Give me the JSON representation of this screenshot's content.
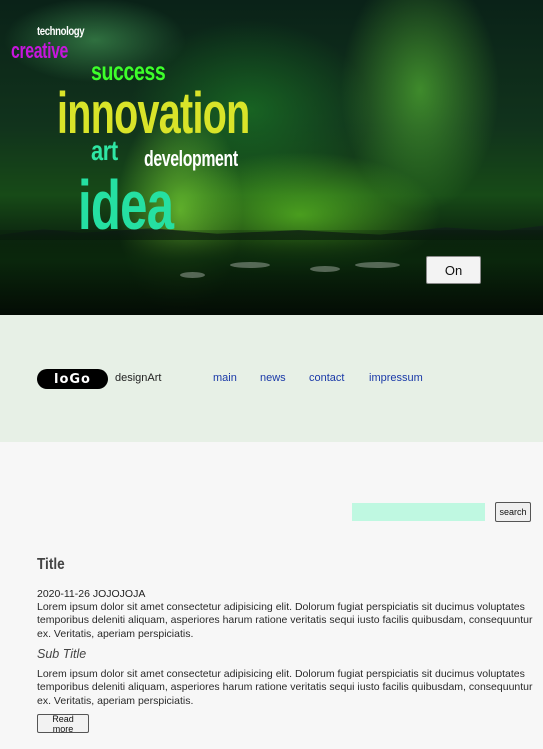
{
  "hero": {
    "words": {
      "technology": "technology",
      "creative": "creative",
      "success": "success",
      "innovation": "innovation",
      "art": "art",
      "development": "development",
      "idea": "idea"
    },
    "toggle_label": "On"
  },
  "header": {
    "logo_text": "loGo",
    "brand_name": "designArt",
    "nav": {
      "main": "main",
      "news": "news",
      "contact": "contact",
      "impressum": "impressum"
    }
  },
  "search": {
    "value": "",
    "button_label": "search"
  },
  "article": {
    "title": "Title",
    "meta": "2020-11-26 JOJOJOJA",
    "body_1": "Lorem ipsum dolor sit amet consectetur adipisicing elit. Dolorum fugiat perspiciatis sit ducimus voluptates temporibus deleniti aliquam, asperiores harum ratione veritatis sequi iusto facilis quibusdam, consequuntur ex. Veritatis, aperiam perspiciatis.",
    "subtitle": "Sub Title",
    "body_2": "Lorem ipsum dolor sit amet consectetur adipisicing elit. Dolorum fugiat perspiciatis sit ducimus voluptates temporibus deleniti aliquam, asperiores harum ratione veritatis sequi iusto facilis quibusdam, consequuntur ex. Veritatis, aperiam perspiciatis.",
    "read_more_label": "Read more"
  },
  "colors": {
    "word_technology": "#ffffff",
    "word_creative": "#c616dc",
    "word_success": "#3dff2a",
    "word_innovation": "#d9e429",
    "word_art": "#2fe6a4",
    "word_development": "#ffffff",
    "word_idea": "#25e0a2",
    "nav_band": "#e7f0e6",
    "search_field": "#bff8e1",
    "nav_link": "#1a39a8",
    "page_background": "#f7f7f7"
  }
}
